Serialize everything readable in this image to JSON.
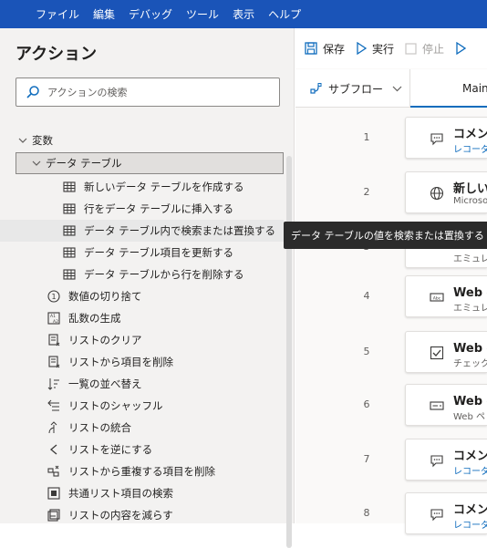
{
  "menu": [
    "ファイル",
    "編集",
    "デバッグ",
    "ツール",
    "表示",
    "ヘルプ"
  ],
  "left_panel": {
    "title": "アクション",
    "search_placeholder": "アクションの検索",
    "group_label": "変数",
    "subgroup_label": "データ テーブル",
    "table_items": [
      "新しいデータ テーブルを作成する",
      "行をデータ テーブルに挿入する",
      "データ テーブル内で検索または置換する",
      "データ テーブル項目を更新する",
      "データ テーブルから行を削除する"
    ],
    "var_items": [
      {
        "label": "数値の切り捨て",
        "icon": "number-circle-icon"
      },
      {
        "label": "乱数の生成",
        "icon": "random-icon"
      },
      {
        "label": "リストのクリア",
        "icon": "list-clear-icon"
      },
      {
        "label": "リストから項目を削除",
        "icon": "list-remove-icon"
      },
      {
        "label": "一覧の並べ替え",
        "icon": "sort-icon"
      },
      {
        "label": "リストのシャッフル",
        "icon": "shuffle-icon"
      },
      {
        "label": "リストの統合",
        "icon": "merge-icon"
      },
      {
        "label": "リストを逆にする",
        "icon": "reverse-icon"
      },
      {
        "label": "リストから重複する項目を削除",
        "icon": "dedupe-icon"
      },
      {
        "label": "共通リスト項目の検索",
        "icon": "common-items-icon"
      },
      {
        "label": "リストの内容を減らす",
        "icon": "subtract-list-icon"
      }
    ]
  },
  "toolbar": {
    "save": "保存",
    "run": "実行",
    "stop": "停止"
  },
  "tabs": {
    "subflow": "サブフロー",
    "main": "Main"
  },
  "steps": [
    {
      "num": "1",
      "title": "コメント",
      "sub": "レコーダー",
      "icon": "comment-icon",
      "link": true
    },
    {
      "num": "2",
      "title": "新しい",
      "sub": "Microso",
      "icon": "globe-icon",
      "link": false
    },
    {
      "num": "3",
      "title": "",
      "sub": "エミュレー",
      "icon": "",
      "link": false
    },
    {
      "num": "4",
      "title": "Web ペ",
      "sub": "エミュレー",
      "icon": "text-field-icon",
      "link": false
    },
    {
      "num": "5",
      "title": "Web ペ",
      "sub": "チェック",
      "icon": "checkbox-icon",
      "link": false
    },
    {
      "num": "6",
      "title": "Web ペ",
      "sub": "Web ペ",
      "icon": "form-icon",
      "link": false
    },
    {
      "num": "7",
      "title": "コメント",
      "sub": "レコーダー",
      "icon": "comment-icon",
      "link": true
    },
    {
      "num": "8",
      "title": "コメント",
      "sub": "レコーダー",
      "icon": "comment-icon",
      "link": true
    }
  ],
  "tooltip": "データ テーブルの値を検索または置換する",
  "colors": {
    "menubar": "#1a54b8",
    "accent": "#0f6cbd",
    "selection": "#e1dfdd"
  }
}
